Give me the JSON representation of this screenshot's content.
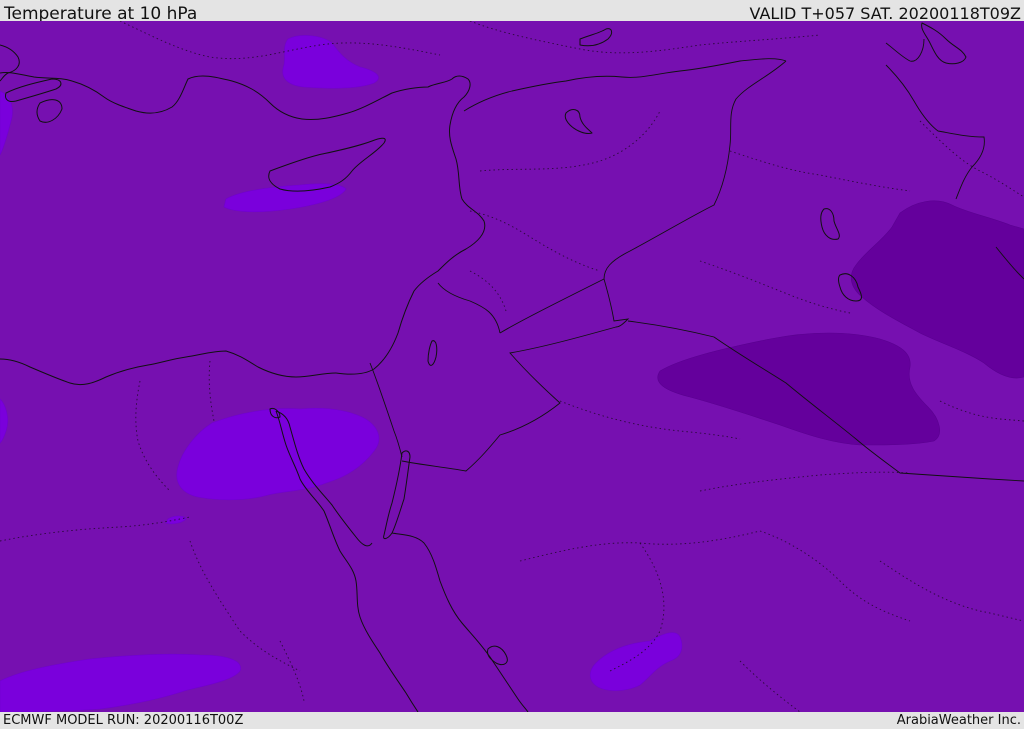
{
  "header": {
    "title": "Temperature at 10 hPa",
    "valid_time": "VALID T+057 SAT. 20200118T09Z"
  },
  "footer": {
    "model_run": "ECMWF MODEL RUN: 20200116T00Z",
    "credit": "ArabiaWeather Inc."
  },
  "map": {
    "colors": {
      "base_fill": "#7610b0",
      "warm_fill": "#7a00dc",
      "cold_fill": "#64009c",
      "coastline": "#111111",
      "border_dotted": "#2a0a3a"
    }
  }
}
